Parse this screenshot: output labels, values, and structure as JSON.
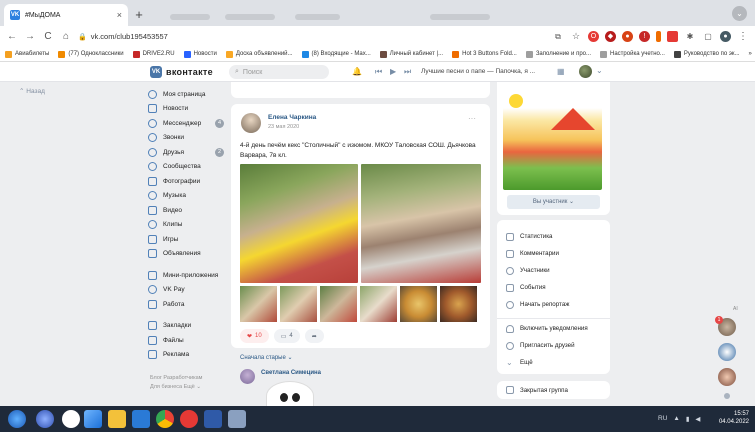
{
  "browser": {
    "tab_title": "#МыДОМА",
    "tab_close": "×",
    "new_tab": "+",
    "url": "vk.com/club195453557",
    "back": "←",
    "forward": "→",
    "reload": "C",
    "home": "⌂",
    "bookmarks": [
      {
        "label": "Авиабилеты",
        "color": "#f4a020"
      },
      {
        "label": "(77) Одноклассники",
        "color": "#f08a00"
      },
      {
        "label": "DRIVE2.RU",
        "color": "#c62828"
      },
      {
        "label": "Новости",
        "color": "#2962ff"
      },
      {
        "label": "Доска объявлений...",
        "color": "#f9a825"
      },
      {
        "label": "(8) Входящие - Мах...",
        "color": "#1e88e5"
      },
      {
        "label": "Личный кабинет |...",
        "color": "#6d4c41"
      },
      {
        "label": "Hot 3 Buttons Fold...",
        "color": "#ef6c00"
      },
      {
        "label": "Заполнение и про...",
        "color": "#9e9e9e"
      },
      {
        "label": "Настройка учетно...",
        "color": "#9e9e9e"
      },
      {
        "label": "Руководство по эк...",
        "color": "#424242"
      }
    ],
    "bookmarks_more": "»"
  },
  "header": {
    "logo_text": "вконтакте",
    "logo_mark": "VK",
    "search_placeholder": "Поиск",
    "player_title": "Лучшие песни о папе — Папочка, я ..."
  },
  "left_nav": {
    "back_label": "Назад",
    "items": [
      {
        "label": "Моя страница",
        "badge": ""
      },
      {
        "label": "Новости",
        "badge": ""
      },
      {
        "label": "Мессенджер",
        "badge": "4"
      },
      {
        "label": "Звонки",
        "badge": ""
      },
      {
        "label": "Друзья",
        "badge": "2"
      },
      {
        "label": "Сообщества",
        "badge": ""
      },
      {
        "label": "Фотографии",
        "badge": ""
      },
      {
        "label": "Музыка",
        "badge": ""
      },
      {
        "label": "Видео",
        "badge": ""
      },
      {
        "label": "Клипы",
        "badge": ""
      },
      {
        "label": "Игры",
        "badge": ""
      },
      {
        "label": "Объявления",
        "badge": ""
      }
    ],
    "items2": [
      {
        "label": "Мини-приложения"
      },
      {
        "label": "VK Pay"
      },
      {
        "label": "Работа"
      }
    ],
    "items3": [
      {
        "label": "Закладки"
      },
      {
        "label": "Файлы"
      },
      {
        "label": "Реклама"
      }
    ],
    "footer": [
      "Блог  Разработчикам",
      "Для бизнеса  Ещё ⌄"
    ]
  },
  "post": {
    "author": "Елена Чаркина",
    "date": "23 мая 2020",
    "more": "···",
    "text": "4-й день печём кекс \"Столичный\" с изюмом. МКОУ Таловская СОШ. Дьячкова Варвара, 7в кл.",
    "likes": "10",
    "comments": "4",
    "sort_label": "Сначала старые ⌄",
    "commenter": "Светлана Симецина"
  },
  "group": {
    "follow_label": "Вы участник ⌄",
    "menu": [
      "Статистика",
      "Комментарии",
      "Участники",
      "События",
      "Начать репортаж",
      "Включить уведомления",
      "Пригласить друзей",
      "Ещё"
    ],
    "closed_label": "Закрытая группа"
  },
  "chat": {
    "ai_label": "AI",
    "badge": "1"
  },
  "taskbar": {
    "lang": "RU",
    "time": "15:57",
    "date": "04.04.2022"
  }
}
